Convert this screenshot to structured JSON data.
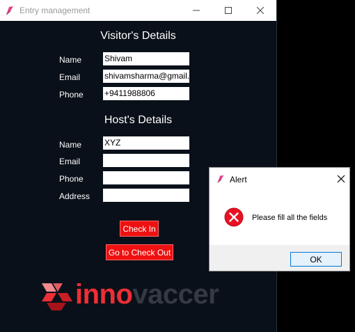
{
  "window": {
    "title": "Entry management"
  },
  "visitor": {
    "heading": "Visitor's Details",
    "name_label": "Name",
    "name_value": "Shivam",
    "email_label": "Email",
    "email_value": "shivamsharma@gmail.",
    "phone_label": "Phone",
    "phone_value": "+9411988806"
  },
  "host": {
    "heading": "Host's Details",
    "name_label": "Name",
    "name_value": "XYZ",
    "email_label": "Email",
    "email_value": "",
    "phone_label": "Phone",
    "phone_value": "",
    "address_label": "Address",
    "address_value": ""
  },
  "buttons": {
    "check_in": "Check In",
    "check_out": "Go to Check Out"
  },
  "logo": {
    "part1": "inno",
    "part2": "vaccer",
    "red": "#ee2e36",
    "grey": "#353a42"
  },
  "alert": {
    "title": "Alert",
    "message": "Please fill all the fields",
    "ok_label": "OK",
    "icon": "error-icon"
  }
}
